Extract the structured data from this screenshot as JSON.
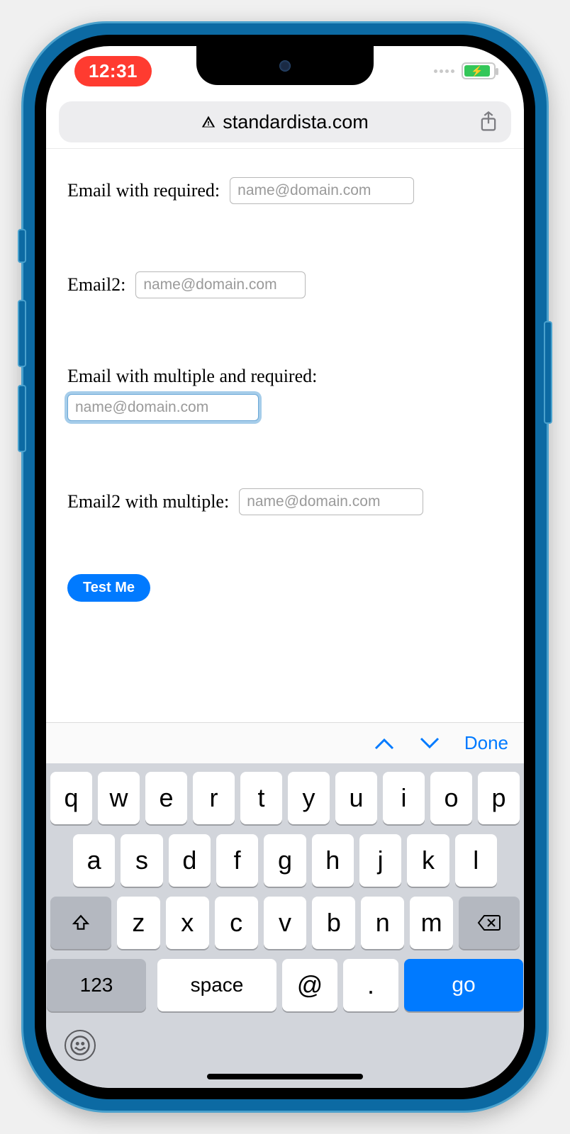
{
  "status": {
    "time": "12:31"
  },
  "address": {
    "domain": "standardista.com"
  },
  "form": {
    "field1": {
      "label": "Email with required:",
      "placeholder": "name@domain.com"
    },
    "field2": {
      "label": "Email2:",
      "placeholder": "name@domain.com"
    },
    "field3": {
      "label": "Email with multiple and required:",
      "placeholder": "name@domain.com"
    },
    "field4": {
      "label": "Email2 with multiple:",
      "placeholder": "name@domain.com"
    },
    "submit": "Test Me"
  },
  "kb_accessory": {
    "done": "Done"
  },
  "keyboard": {
    "row1": [
      "q",
      "w",
      "e",
      "r",
      "t",
      "y",
      "u",
      "i",
      "o",
      "p"
    ],
    "row2": [
      "a",
      "s",
      "d",
      "f",
      "g",
      "h",
      "j",
      "k",
      "l"
    ],
    "row3": [
      "z",
      "x",
      "c",
      "v",
      "b",
      "n",
      "m"
    ],
    "numbers": "123",
    "space": "space",
    "at": "@",
    "dot": ".",
    "go": "go"
  }
}
